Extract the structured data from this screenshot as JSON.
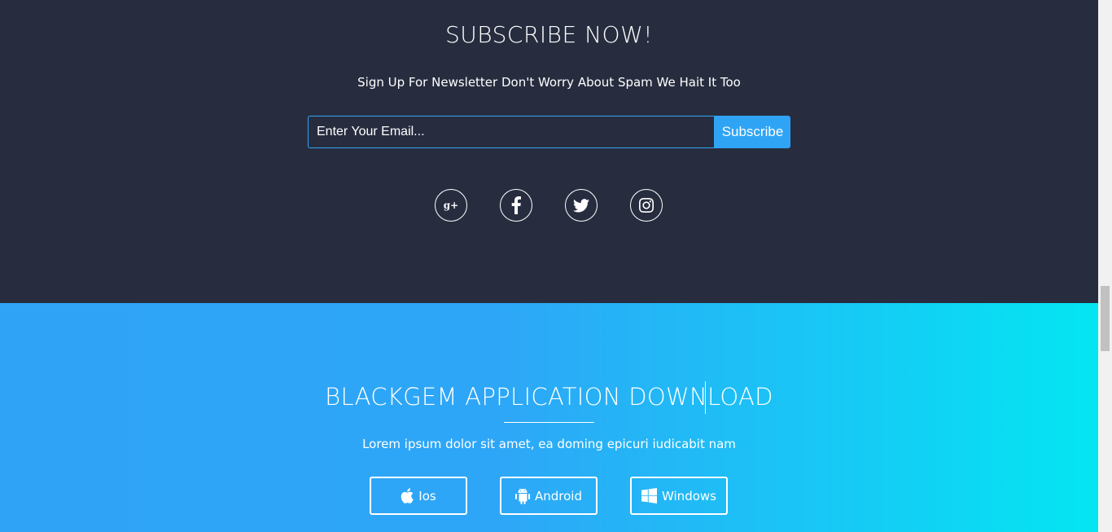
{
  "subscribe": {
    "title": "SUBSCRIBE NOW!",
    "text": "Sign Up For Newsletter Don't Worry About Spam We Hait It Too",
    "email_placeholder": "Enter Your Email...",
    "button_label": "Subscribe",
    "social_icons": [
      "google-plus-icon",
      "facebook-icon",
      "twitter-icon",
      "instagram-icon"
    ],
    "gplus_glyph": "g+"
  },
  "download": {
    "title": "BLACKGEM APPLICATION DOWNLOAD",
    "text": "Lorem ipsum dolor sit amet, ea doming epicuri iudicabit nam",
    "buttons": [
      {
        "label": "Ios",
        "icon": "apple-icon"
      },
      {
        "label": "Android",
        "icon": "android-icon"
      },
      {
        "label": "Windows",
        "icon": "windows-icon"
      }
    ]
  },
  "colors": {
    "dark_bg": "#272d3f",
    "accent": "#2fa4f5",
    "gradient_end": "#03e6f1"
  }
}
